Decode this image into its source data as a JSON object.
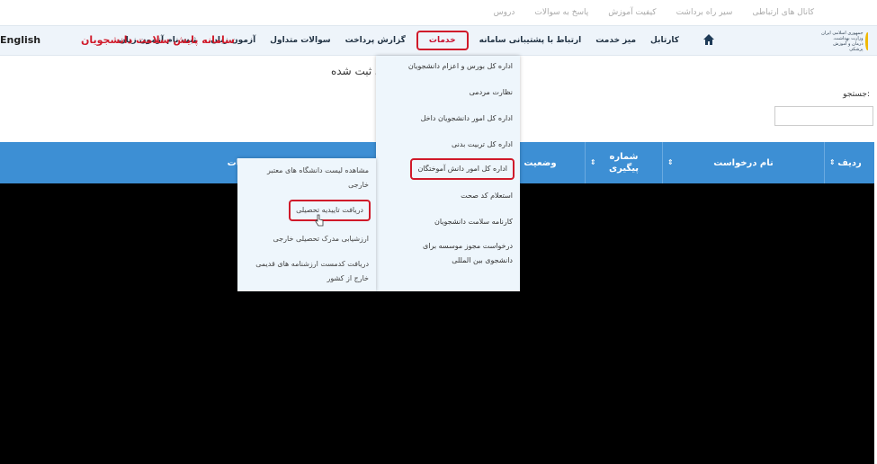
{
  "topbar": {
    "links": [
      "کانال های ارتباطی",
      "سیر راه برداشت",
      "کیفیت آموزش",
      "پاسخ به سوالات",
      "دروس"
    ]
  },
  "header": {
    "logo_text": "جمهوری اسلامی ایران وزارت بهداشت، درمان و آموزش پزشکی",
    "brand_title": "سامانه پایش سلامت دانشجویان",
    "lang_label": "English",
    "nav": [
      {
        "label": "کارتابل"
      },
      {
        "label": "میز خدمت"
      },
      {
        "label": "ارتباط با پشتیبانی سامانه"
      },
      {
        "label": "خدمات",
        "active": true
      },
      {
        "label": "گزارش پرداخت"
      },
      {
        "label": "سوالات متداول"
      },
      {
        "label": "آزمون زبان"
      },
      {
        "label": "ثبت نام آزمون زبان"
      }
    ]
  },
  "main": {
    "title": "درخواست های ثبت شده",
    "search_label": "جستجو:",
    "search_value": ""
  },
  "table": {
    "columns": [
      "ردیف",
      "نام درخواست",
      "شماره پیگیری",
      "وضعیت",
      "توضیحات"
    ]
  },
  "services_menu": {
    "items": [
      "اداره کل بورس و اعزام دانشجویان",
      "نظارت مردمی",
      "اداره کل امور دانشجویان داخل",
      "اداره کل تربیت بدنی",
      "اداره کل امور دانش آموختگان",
      "استعلام کد صحت",
      "کارنامه سلامت دانشجویان",
      "درخواست مجوز موسسه برای دانشجوی بین المللی"
    ],
    "highlighted_index": 4
  },
  "graduates_submenu": {
    "items": [
      "مشاهده لیست دانشگاه های معتبر خارجی",
      "دریافت تاییدیه تحصیلی",
      "ارزشیابی مدرک تحصیلی خارجی",
      "دریافت کدمست ارزشنامه های قدیمی خارج از کشور"
    ],
    "highlighted_index": 1
  },
  "colors": {
    "accent": "#3d8fd4",
    "highlight": "#d01a2a",
    "menu_bg": "#eef6fc"
  }
}
